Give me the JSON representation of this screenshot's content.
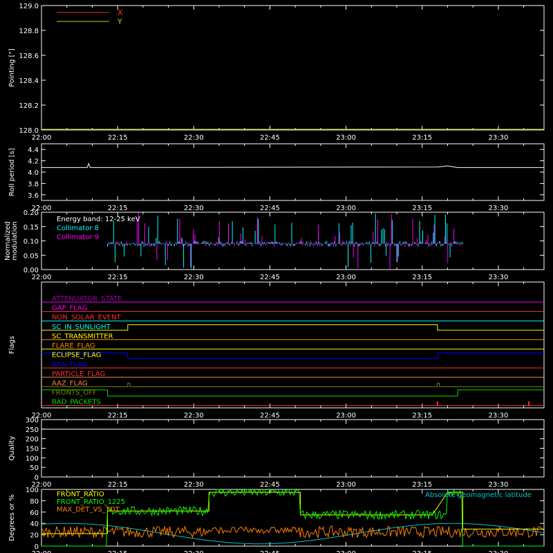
{
  "chart_data": [
    {
      "type": "line",
      "ylabel": "Pointing [\"]",
      "ylim": [
        128.0,
        129.0
      ],
      "yticks": [
        "128.0",
        "128.2",
        "128.4",
        "128.6",
        "128.8",
        "129.0"
      ],
      "xticks": [
        "22:00",
        "22:15",
        "22:30",
        "22:45",
        "23:00",
        "23:15",
        "23:30"
      ],
      "legend": [
        "X",
        "Y"
      ],
      "colors": {
        "X": "#ff3030",
        "Y": "#c8c800"
      },
      "series": [
        {
          "name": "X",
          "values": []
        },
        {
          "name": "Y",
          "values": []
        }
      ]
    },
    {
      "type": "line",
      "ylabel": "Roll period [s]",
      "ylim": [
        3.5,
        4.5
      ],
      "yticks": [
        "3.6",
        "3.8",
        "4.0",
        "4.2",
        "4.4"
      ],
      "xticks": [
        "22:00",
        "22:15",
        "22:30",
        "22:45",
        "23:00",
        "23:15",
        "23:30"
      ],
      "series": [
        {
          "values": [
            [
              0,
              4.08
            ],
            [
              9,
              4.08
            ],
            [
              9.3,
              4.15
            ],
            [
              9.6,
              4.08
            ],
            [
              78,
              4.09
            ],
            [
              80,
              4.11
            ],
            [
              82,
              4.08
            ],
            [
              99,
              4.08
            ]
          ]
        }
      ]
    },
    {
      "type": "bar",
      "ylabel": "Normalized modulation",
      "ylim": [
        0.0,
        0.2
      ],
      "yticks": [
        "0.00",
        "0.05",
        "0.10",
        "0.15",
        "0.20"
      ],
      "xticks": [
        "22:00",
        "22:15",
        "22:30",
        "22:45",
        "23:00",
        "23:15",
        "23:30"
      ],
      "legend_title": "Energy band: 12-25 keV",
      "series": [
        {
          "name": "Collimator 8",
          "color": "#00ffff",
          "range": [
            13,
            83
          ],
          "baseline": 0.09
        },
        {
          "name": "Collimator 9",
          "color": "#ff00ff",
          "range": [
            13,
            83
          ],
          "baseline": 0.09
        }
      ]
    },
    {
      "type": "line",
      "ylabel": "Flags",
      "xticks": [
        "22:00",
        "22:15",
        "22:30",
        "22:45",
        "23:00",
        "23:15",
        "23:30"
      ],
      "flags": [
        {
          "name": "ATTENUATOR_STATE",
          "color": "#a000a0"
        },
        {
          "name": "GAP_FLAG",
          "color": "#ff00ff"
        },
        {
          "name": "NON_SOLAR_EVENT",
          "color": "#ff3030"
        },
        {
          "name": "SC_IN_SUNLIGHT",
          "color": "#00ffff"
        },
        {
          "name": "SC_TRANSMITTER",
          "color": "#ffff00"
        },
        {
          "name": "FLARE_FLAG",
          "color": "#ff8000"
        },
        {
          "name": "ECLIPSE_FLAG",
          "color": "#ffff00"
        },
        {
          "name": "SAA_FLAG",
          "color": "#0000ff"
        },
        {
          "name": "PARTICLE_FLAG",
          "color": "#ff3030"
        },
        {
          "name": "AAZ_FLAG",
          "color": "#ff8040"
        },
        {
          "name": "FRONTS_OFF",
          "color": "#808000"
        },
        {
          "name": "BAD_PACKETS",
          "color": "#00e000"
        }
      ],
      "sunlight_on": [
        17,
        78
      ],
      "eclipse_off": [
        17,
        78
      ],
      "aaz_pulses": [
        17,
        78
      ],
      "fronts_off_high": [
        13,
        82
      ],
      "bad_packet_spikes": [
        78,
        96
      ]
    },
    {
      "type": "line",
      "ylabel": "Quality",
      "ylim": [
        0,
        300
      ],
      "yticks": [
        "0",
        "50",
        "100",
        "150",
        "200",
        "250",
        "300"
      ],
      "xticks": [
        "22:00",
        "22:15",
        "22:30",
        "22:45",
        "23:00",
        "23:15",
        "23:30"
      ],
      "series": []
    },
    {
      "type": "line",
      "ylabel": "Degrees or %",
      "ylim": [
        0,
        100
      ],
      "yticks": [
        "0",
        "20",
        "40",
        "60",
        "80",
        "100"
      ],
      "xticks": [
        "22:00",
        "22:15",
        "22:30",
        "22:45",
        "23:00",
        "23:15",
        "23:30"
      ],
      "legend": [
        "FRONT_RATIO",
        "FRONT_RATIO_1225",
        "MAX_DET_VS_TOT"
      ],
      "annotation": "Absolute geomagnetic latitude",
      "series": [
        {
          "name": "FRONT_RATIO",
          "color": "#ffff00",
          "values": [
            [
              0,
              22
            ],
            [
              13,
              22
            ],
            [
              13,
              62
            ],
            [
              33,
              62
            ],
            [
              33,
              95
            ],
            [
              51,
              95
            ],
            [
              51,
              55
            ],
            [
              77,
              55
            ],
            [
              80,
              95
            ],
            [
              83,
              95
            ],
            [
              83,
              30
            ],
            [
              99,
              30
            ]
          ]
        },
        {
          "name": "FRONT_RATIO_1225",
          "color": "#00ff00",
          "values": [
            [
              0,
              0
            ],
            [
              13,
              0
            ],
            [
              13,
              62
            ],
            [
              33,
              62
            ],
            [
              33,
              95
            ],
            [
              51,
              95
            ],
            [
              51,
              55
            ],
            [
              77,
              55
            ],
            [
              80,
              95
            ],
            [
              83,
              95
            ],
            [
              83,
              0
            ],
            [
              99,
              0
            ]
          ]
        },
        {
          "name": "MAX_DET_VS_TOT",
          "color": "#ff8000",
          "baseline": 25
        },
        {
          "name": "Absolute geomagnetic latitude",
          "color": "#00c8c8",
          "values": [
            [
              0,
              30
            ],
            [
              10,
              15
            ],
            [
              20,
              4
            ],
            [
              30,
              12
            ],
            [
              40,
              28
            ],
            [
              50,
              30
            ],
            [
              60,
              20
            ],
            [
              70,
              5
            ],
            [
              78,
              8
            ],
            [
              88,
              40
            ],
            [
              99,
              28
            ]
          ]
        }
      ]
    }
  ]
}
